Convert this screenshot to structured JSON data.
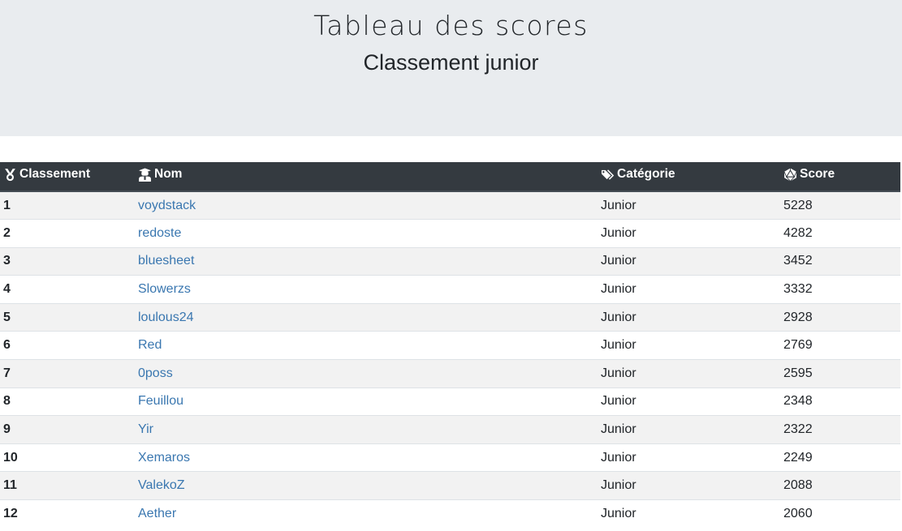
{
  "header": {
    "title": "Tableau des scores",
    "subtitle": "Classement junior"
  },
  "table": {
    "columns": [
      {
        "label": "Classement",
        "icon": "medal-icon"
      },
      {
        "label": "Nom",
        "icon": "student-icon"
      },
      {
        "label": "Catégorie",
        "icon": "tags-icon"
      },
      {
        "label": "Score",
        "icon": "dice-d20-icon"
      }
    ],
    "rows": [
      {
        "rank": "1",
        "name": "voydstack",
        "category": "Junior",
        "score": "5228"
      },
      {
        "rank": "2",
        "name": "redoste",
        "category": "Junior",
        "score": "4282"
      },
      {
        "rank": "3",
        "name": "bluesheet",
        "category": "Junior",
        "score": "3452"
      },
      {
        "rank": "4",
        "name": "Slowerzs",
        "category": "Junior",
        "score": "3332"
      },
      {
        "rank": "5",
        "name": "loulous24",
        "category": "Junior",
        "score": "2928"
      },
      {
        "rank": "6",
        "name": "Red",
        "category": "Junior",
        "score": "2769"
      },
      {
        "rank": "7",
        "name": "0poss",
        "category": "Junior",
        "score": "2595"
      },
      {
        "rank": "8",
        "name": "Feuillou",
        "category": "Junior",
        "score": "2348"
      },
      {
        "rank": "9",
        "name": "Yir",
        "category": "Junior",
        "score": "2322"
      },
      {
        "rank": "10",
        "name": "Xemaros",
        "category": "Junior",
        "score": "2249"
      },
      {
        "rank": "11",
        "name": "ValekoZ",
        "category": "Junior",
        "score": "2088"
      },
      {
        "rank": "12",
        "name": "Aether",
        "category": "Junior",
        "score": "2060"
      }
    ]
  },
  "colors": {
    "header_bg": "#343a40",
    "jumbotron_bg": "#e9ecef",
    "link": "#3a77b0",
    "stripe": "#f2f2f2"
  }
}
